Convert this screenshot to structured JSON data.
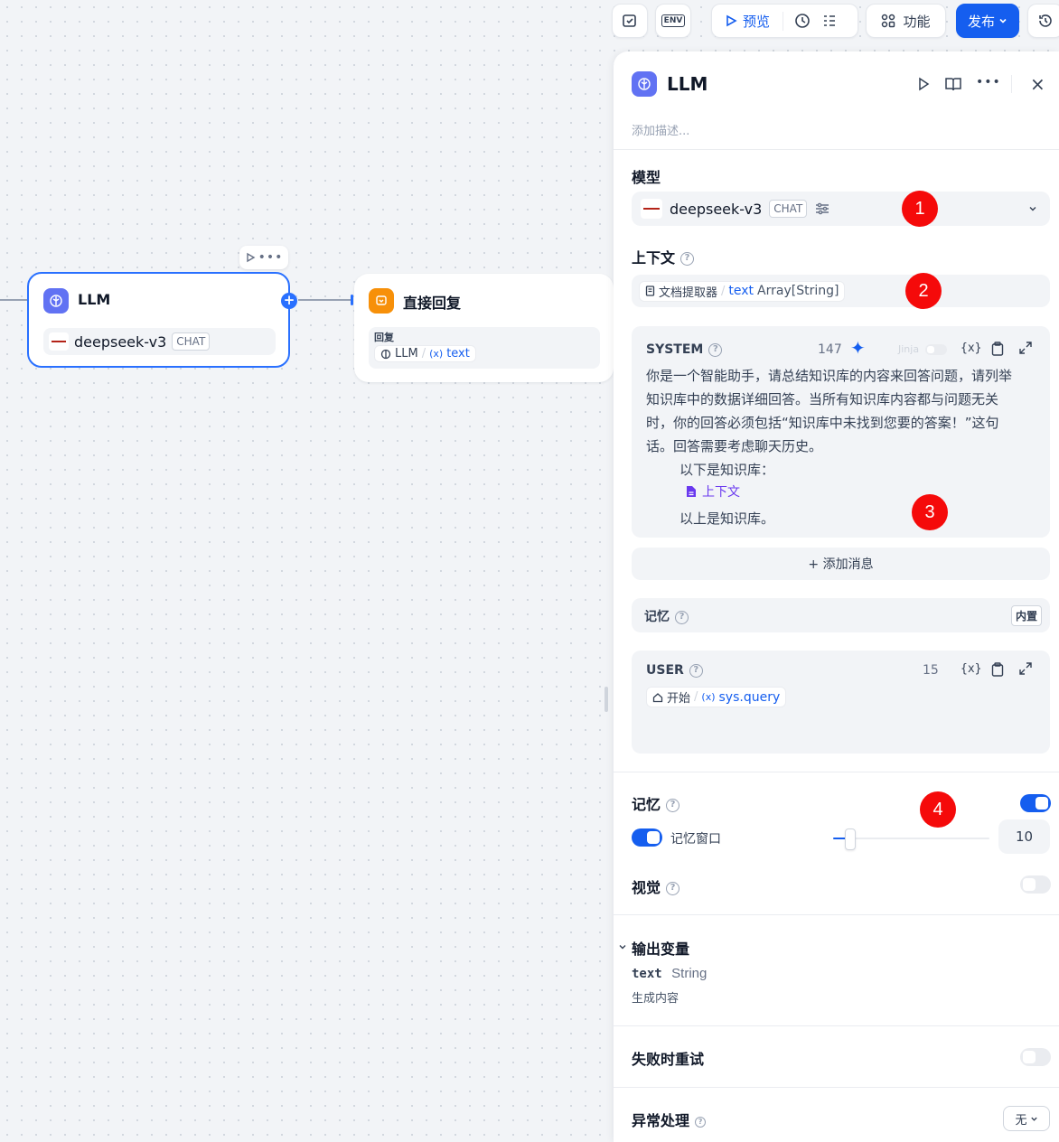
{
  "toolbar": {
    "preview_label": "预览",
    "features_label": "功能",
    "publish_label": "发布",
    "env_label": "ENV"
  },
  "canvas": {
    "llm_node": {
      "title": "LLM",
      "model": "deepseek-v3",
      "model_mode": "CHAT"
    },
    "answer_node": {
      "title": "直接回复",
      "field_label": "回复",
      "var_node": "LLM",
      "var_sep": "/",
      "var_name": "text"
    }
  },
  "panel": {
    "title": "LLM",
    "description_placeholder": "添加描述...",
    "model_label": "模型",
    "model_name": "deepseek-v3",
    "model_mode": "CHAT",
    "context_label": "上下文",
    "context_node": "文档提取器",
    "context_sep": "/",
    "context_var": "text",
    "context_type": "Array[String]",
    "system": {
      "label": "SYSTEM",
      "count": "147",
      "jinja_label": "Jinja",
      "var_icon": "{x}",
      "text_lines": [
        "你是一个智能助手，请总结知识库的内容来回答问题，请列举",
        "知识库中的数据详细回答。当所有知识库内容都与问题无关",
        "时，你的回答必须包括“知识库中未找到您要的答案！”这句",
        "话。回答需要考虑聊天历史。"
      ],
      "kb_before": "以下是知识库：",
      "context_tag": "上下文",
      "kb_after": "以上是知识库。"
    },
    "add_message_label": "+ 添加消息",
    "memory_row": {
      "label": "记忆",
      "badge": "内置"
    },
    "user": {
      "label": "USER",
      "count": "15",
      "var_icon": "{x}",
      "var_node": "开始",
      "var_sep": "/",
      "var_name": "sys.query"
    },
    "memory": {
      "label": "记忆",
      "enabled": true,
      "window_label": "记忆窗口",
      "window_enabled": true,
      "window_value": "10",
      "slider_fraction": 0.11
    },
    "vision": {
      "label": "视觉",
      "enabled": false
    },
    "output": {
      "label": "输出变量",
      "var_name": "text",
      "var_type": "String",
      "var_desc": "生成内容"
    },
    "retry": {
      "label": "失败时重试",
      "enabled": false
    },
    "error": {
      "label": "异常处理",
      "value": "无"
    }
  },
  "markers": [
    "1",
    "2",
    "3",
    "4"
  ],
  "colors": {
    "accent": "#155eef",
    "llm_icon": "#6172f3",
    "answer_icon": "#f79009",
    "marker": "#f50a0a"
  }
}
